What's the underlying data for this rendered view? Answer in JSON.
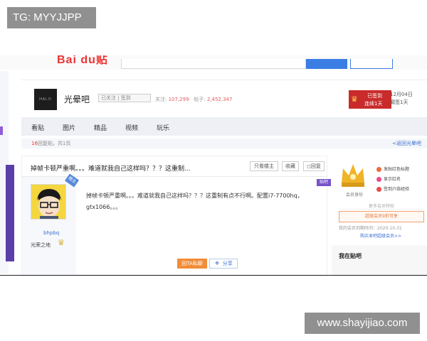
{
  "watermarks": {
    "top_left": "TG: MYYJJPP",
    "bottom_right": "www.shayijiao.com"
  },
  "forum": {
    "name": "光晕吧",
    "logo_text": "HALO",
    "follow_label": "已关注 | 签到",
    "stats": {
      "members_label": "关注:",
      "members": "107,299",
      "posts_label": "帖子:",
      "posts": "2,452,347"
    },
    "sign": {
      "line1": "已签到",
      "line2": "连续1天",
      "date": "12月04日",
      "days": "漏签1天"
    }
  },
  "nav": {
    "tabs": [
      "看贴",
      "图片",
      "精品",
      "视频",
      "玩乐"
    ]
  },
  "thread_bar": {
    "count_num": "16",
    "count_text": "回复贴，共1页",
    "back_link": "<返回光晕吧"
  },
  "post": {
    "title": "掉帧卡顿严重啊。。。难道就我自己这样吗？？？这重制...",
    "buttons": {
      "only_op": "只看楼主",
      "favorite": "收藏",
      "reply": "回复"
    },
    "floor_badge": "楼主",
    "app_tag": "贴吧",
    "author": {
      "name": "bhpbq",
      "badge": "光荣之地"
    },
    "body": "掉帧卡顿严重啊。。。难道就我自己这样吗？？？这重制有点不行啊。配置i7-7700hq，gtx1066。。。",
    "reply_btn": "回TA私聊",
    "share_btn": "分享"
  },
  "sidebar": {
    "crown_label": "会员身份",
    "items": [
      "发贴红色标题",
      "显示红名",
      "签到六倍经验"
    ],
    "divider": "更多会员特权",
    "vip_btn": "超级会员9折可享",
    "expire": "我的会员到期时间：2020-10-31",
    "buy": "购买本吧超级会员>>",
    "section_title": "我在贴吧"
  },
  "colors": {
    "accent_blue": "#3a7ee4",
    "sign_red": "#c92b2b",
    "reply_orange": "#f28c38",
    "avatar_yellow": "#f3d640"
  }
}
